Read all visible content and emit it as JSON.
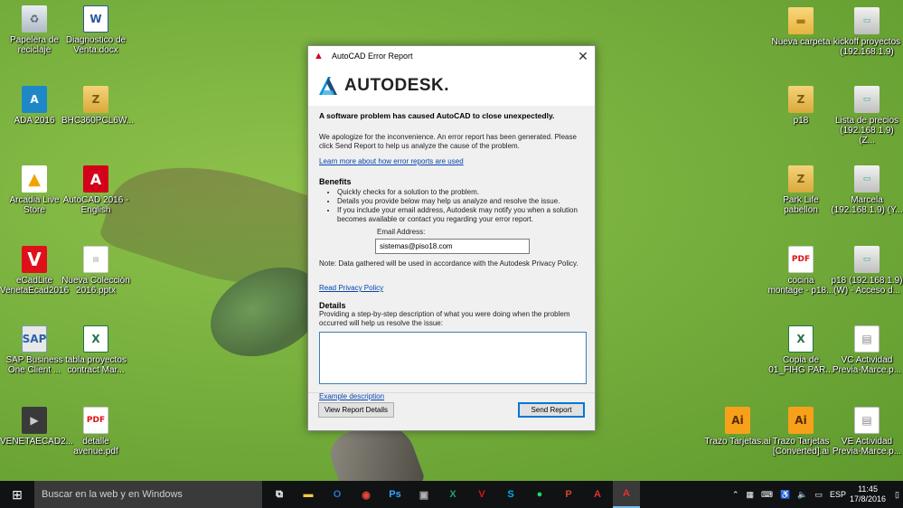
{
  "desktop": {
    "icons": [
      {
        "label": "Papelera de\nreciclaje",
        "glyph": "♻"
      },
      {
        "label": "Diagnostico de\nVenta.docx",
        "glyph": "W"
      },
      {
        "label": "Nueva carpeta",
        "glyph": "▬"
      },
      {
        "label": "kickoff proyectos\n(192.168.1.9)",
        "glyph": "▭"
      },
      {
        "label": "ADA 2016",
        "glyph": "A"
      },
      {
        "label": "BHC360PCL6W...",
        "glyph": "Z"
      },
      {
        "label": "p18",
        "glyph": "Z"
      },
      {
        "label": "Lista de precios\n(192.168.1.9) (Z...",
        "glyph": "▭"
      },
      {
        "label": "Arcadia Live\nStore",
        "glyph": "▲"
      },
      {
        "label": "AutoCAD 2016 -\nEnglish",
        "glyph": "A"
      },
      {
        "label": "Park Life\npabellon",
        "glyph": "Z"
      },
      {
        "label": "Marcela\n(192.168.1.9) (Y...",
        "glyph": "▭"
      },
      {
        "label": "eCadLite\nVenetaEcad2016",
        "glyph": "V"
      },
      {
        "label": "Nueva Colección\n2016.pptx",
        "glyph": "▤"
      },
      {
        "label": "cocina\nmontage - p18...",
        "glyph": "PDF"
      },
      {
        "label": "p18 (192.168.1.9)\n(W) - Acceso d...",
        "glyph": "▭"
      },
      {
        "label": "SAP Business\nOne Client ...",
        "glyph": "SAP"
      },
      {
        "label": "tabla proyectos\ncontract Mar...",
        "glyph": "X"
      },
      {
        "label": "Copia de\n01_FIHG PAR...",
        "glyph": "X"
      },
      {
        "label": "VC Actividad\nPrevia-Marce.p...",
        "glyph": "▤"
      },
      {
        "label": "VENETAECAD2...",
        "glyph": "▶"
      },
      {
        "label": "detalle\navenue.pdf",
        "glyph": "PDF"
      },
      {
        "label": "Trazo Tarjetas.ai",
        "glyph": "Ai"
      },
      {
        "label": "Trazo Tarjetas\n[Converted].ai",
        "glyph": "Ai"
      },
      {
        "label": "VE Actividad\nPrevia-Marce.p...",
        "glyph": "▤"
      }
    ]
  },
  "dialog": {
    "title": "AutoCAD Error Report",
    "logo_text": "AUTODESK.",
    "headline": "A software problem has caused AutoCAD to close unexpectedly.",
    "apology": "We apologize for the inconvenience. An error report has been generated. Please click Send Report to help us analyze the cause of the problem.",
    "learn_more": "Learn more about how error reports are used",
    "benefits_title": "Benefits",
    "benefits": [
      "Quickly checks for a solution to the problem.",
      "Details you provide below may help us analyze and resolve the issue.",
      "If you include your email address, Autodesk may notify you when a solution becomes available or contact you regarding your error report."
    ],
    "email_label": "Email Address:",
    "email_value": "sistemas@piso18.com",
    "note": "Note: Data gathered will be used in accordance with the Autodesk Privacy Policy.",
    "privacy_link": "Read Privacy Policy",
    "details_title": "Details",
    "details_desc": "Providing a step-by-step description of what you were doing when the problem occurred will help us resolve the issue:",
    "details_value": "",
    "example_link": "Example description",
    "view_btn": "View Report Details",
    "send_btn": "Send Report"
  },
  "taskbar": {
    "search_placeholder": "Buscar en la web y en Windows",
    "apps": [
      {
        "name": "task-view",
        "glyph": "⧉",
        "color": "#ffffff"
      },
      {
        "name": "file-explorer",
        "glyph": "▬",
        "color": "#f3c94c"
      },
      {
        "name": "outlook",
        "glyph": "O",
        "color": "#2a72c8"
      },
      {
        "name": "chrome",
        "glyph": "◉",
        "color": "#e8463b"
      },
      {
        "name": "photoshop",
        "glyph": "Ps",
        "color": "#31a8ff"
      },
      {
        "name": "app-generic",
        "glyph": "▣",
        "color": "#b0b0b0"
      },
      {
        "name": "excel",
        "glyph": "X",
        "color": "#21a366"
      },
      {
        "name": "veneta",
        "glyph": "V",
        "color": "#e0101a"
      },
      {
        "name": "skype",
        "glyph": "S",
        "color": "#00aff0"
      },
      {
        "name": "spotify",
        "glyph": "●",
        "color": "#1ed760"
      },
      {
        "name": "powerpoint",
        "glyph": "P",
        "color": "#d24726"
      },
      {
        "name": "acrobat",
        "glyph": "A",
        "color": "#e3302e"
      },
      {
        "name": "autocad",
        "glyph": "A",
        "color": "#e3302e"
      }
    ],
    "language": "ESP",
    "time": "11:45",
    "date": "17/8/2016"
  }
}
